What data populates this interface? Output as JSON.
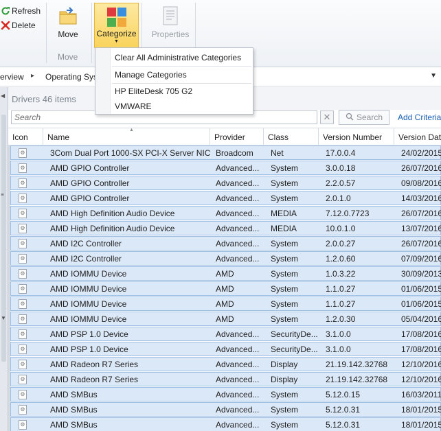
{
  "ribbon": {
    "refresh_label": "Refresh",
    "delete_label": "Delete",
    "move_label": "Move",
    "move_group_label": "Move",
    "categorize_label": "Categorize",
    "properties_label": "Properties"
  },
  "nav": {
    "crumb1": "erview",
    "crumb2": "Operating Sys"
  },
  "content": {
    "title": "Drivers 46 items"
  },
  "search": {
    "placeholder": "Search",
    "button_label": "Search",
    "add_criteria": "Add Criteria"
  },
  "grid": {
    "columns": [
      "Icon",
      "Name",
      "Provider",
      "Class",
      "Version Number",
      "Version Date"
    ],
    "rows": [
      {
        "name": "3Com Dual Port 1000-SX PCI-X Server NIC",
        "provider": "Broadcom",
        "class": "Net",
        "version": "17.0.0.4",
        "date": "24/02/2015"
      },
      {
        "name": "AMD GPIO Controller",
        "provider": "Advanced...",
        "class": "System",
        "version": "3.0.0.18",
        "date": "26/07/2016"
      },
      {
        "name": "AMD GPIO Controller",
        "provider": "Advanced...",
        "class": "System",
        "version": "2.2.0.57",
        "date": "09/08/2016"
      },
      {
        "name": "AMD GPIO Controller",
        "provider": "Advanced...",
        "class": "System",
        "version": "2.0.1.0",
        "date": "14/03/2016"
      },
      {
        "name": "AMD High Definition Audio Device",
        "provider": "Advanced...",
        "class": "MEDIA",
        "version": "7.12.0.7723",
        "date": "26/07/2016"
      },
      {
        "name": "AMD High Definition Audio Device",
        "provider": "Advanced...",
        "class": "MEDIA",
        "version": "10.0.1.0",
        "date": "13/07/2016"
      },
      {
        "name": "AMD I2C Controller",
        "provider": "Advanced...",
        "class": "System",
        "version": "2.0.0.27",
        "date": "26/07/2016"
      },
      {
        "name": "AMD I2C Controller",
        "provider": "Advanced...",
        "class": "System",
        "version": "1.2.0.60",
        "date": "07/09/2016"
      },
      {
        "name": "AMD IOMMU Device",
        "provider": "AMD",
        "class": "System",
        "version": "1.0.3.22",
        "date": "30/09/2013"
      },
      {
        "name": "AMD IOMMU Device",
        "provider": "AMD",
        "class": "System",
        "version": "1.1.0.27",
        "date": "01/06/2015"
      },
      {
        "name": "AMD IOMMU Device",
        "provider": "AMD",
        "class": "System",
        "version": "1.1.0.27",
        "date": "01/06/2015"
      },
      {
        "name": "AMD IOMMU Device",
        "provider": "AMD",
        "class": "System",
        "version": "1.2.0.30",
        "date": "05/04/2016"
      },
      {
        "name": "AMD PSP 1.0 Device",
        "provider": "Advanced...",
        "class": "SecurityDe...",
        "version": "3.1.0.0",
        "date": "17/08/2016"
      },
      {
        "name": "AMD PSP 1.0 Device",
        "provider": "Advanced...",
        "class": "SecurityDe...",
        "version": "3.1.0.0",
        "date": "17/08/2016"
      },
      {
        "name": "AMD Radeon R7 Series",
        "provider": "Advanced...",
        "class": "Display",
        "version": "21.19.142.32768",
        "date": "12/10/2016"
      },
      {
        "name": "AMD Radeon R7 Series",
        "provider": "Advanced...",
        "class": "Display",
        "version": "21.19.142.32768",
        "date": "12/10/2016"
      },
      {
        "name": "AMD SMBus",
        "provider": "Advanced...",
        "class": "System",
        "version": "5.12.0.15",
        "date": "16/03/2011"
      },
      {
        "name": "AMD SMBus",
        "provider": "Advanced...",
        "class": "System",
        "version": "5.12.0.31",
        "date": "18/01/2015"
      },
      {
        "name": "AMD SMBus",
        "provider": "Advanced...",
        "class": "System",
        "version": "5.12.0.31",
        "date": "18/01/2015"
      }
    ]
  },
  "menu": {
    "items": [
      "Clear All Administrative Categories",
      "Manage Categories",
      "HP EliteDesk 705 G2",
      "VMWARE"
    ]
  },
  "icons": {
    "refresh": "refresh-icon",
    "delete": "delete-icon",
    "move": "folder-move-icon",
    "categorize": "categorize-icon",
    "properties": "properties-icon",
    "driver": "driver-icon"
  },
  "colors": {
    "row_selected": "#dbe8f7",
    "row_border": "#9fbfe4",
    "categorize_active": "#f9d35c",
    "link": "#1a5fb4"
  }
}
